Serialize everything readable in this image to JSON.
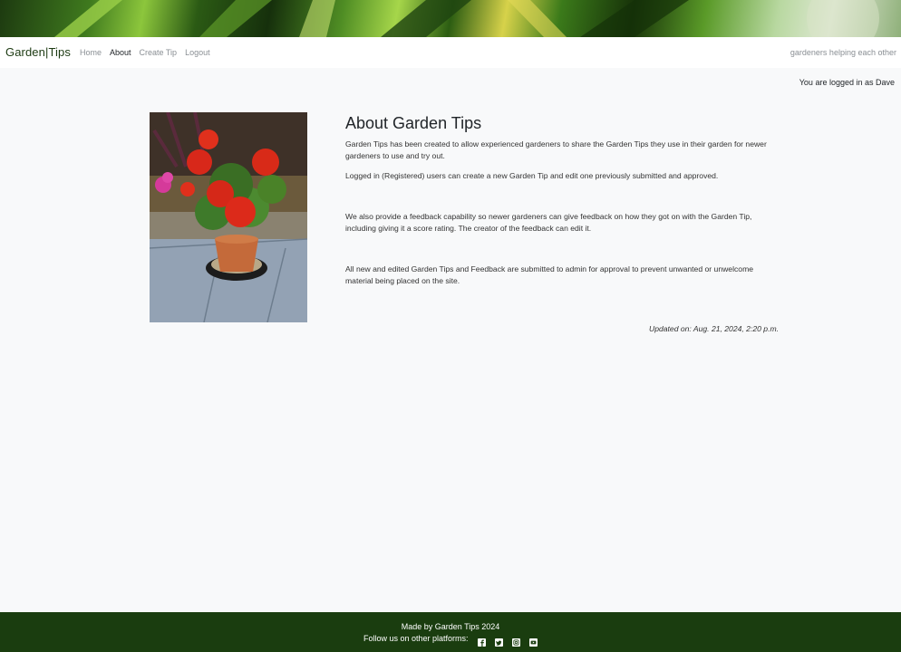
{
  "navbar": {
    "brand": "Garden|Tips",
    "links": [
      {
        "label": "Home"
      },
      {
        "label": "About"
      },
      {
        "label": "Create Tip"
      },
      {
        "label": "Logout"
      }
    ],
    "tagline": "gardeners helping each other"
  },
  "login_status": "You are logged in as Dave",
  "about": {
    "title": "About Garden Tips",
    "paragraphs": [
      "Garden Tips has been created to allow experienced gardeners to share the Garden Tips they use in their garden for newer gardeners to use and try out.",
      "Logged in (Registered) users can create a new Garden Tip and edit one previously submitted and approved.",
      "We also provide a feedback capability so newer gardeners can give feedback on how they got on with the Garden Tip, including giving it a score rating.  The creator of the feedback can edit it.",
      "All new and edited Garden Tips and Feedback are submitted to admin for approval to prevent unwanted or unwelcome material being placed on the site."
    ],
    "updated": "Updated on: Aug. 21, 2024, 2:20 p.m."
  },
  "footer": {
    "made_by": "Made by Garden Tips 2024",
    "follow": "Follow us on other platforms:",
    "social_icons": [
      "facebook-icon",
      "twitter-icon",
      "instagram-icon",
      "youtube-icon"
    ]
  },
  "colors": {
    "footer_bg": "#1a3d0f",
    "brand": "#1c3a12",
    "page_bg": "#f8f9fa"
  }
}
